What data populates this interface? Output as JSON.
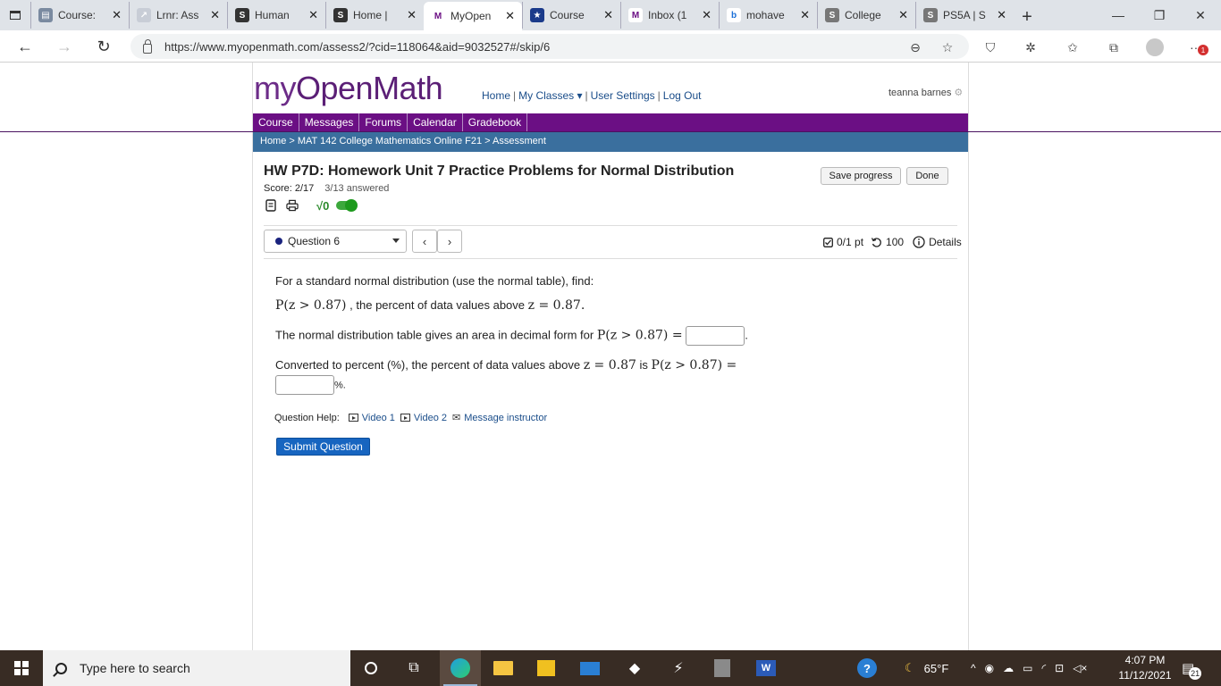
{
  "browser": {
    "tabs": [
      {
        "label": "Course:",
        "fav_bg": "#7a8aa0",
        "fav": "▤"
      },
      {
        "label": "Lrnr: Ass",
        "fav_bg": "#c8cdd6",
        "fav": "↗"
      },
      {
        "label": "Human",
        "fav_bg": "#333333",
        "fav": "S"
      },
      {
        "label": "Home |",
        "fav_bg": "#333333",
        "fav": "S"
      },
      {
        "label": "MyOpen",
        "fav_bg": "#ffffff",
        "fav": "M",
        "active": true
      },
      {
        "label": "Course",
        "fav_bg": "#1a3a8a",
        "fav": "★"
      },
      {
        "label": "Inbox (1",
        "fav_bg": "#ffffff",
        "fav": "M"
      },
      {
        "label": "mohave",
        "fav_bg": "#ffffff",
        "fav": "b"
      },
      {
        "label": "College",
        "fav_bg": "#777777",
        "fav": "S"
      },
      {
        "label": "PS5A | S",
        "fav_bg": "#777777",
        "fav": "S"
      }
    ],
    "url": "https://www.myopenmath.com/assess2/?cid=118064&aid=9032527#/skip/6",
    "ext_badge": "1"
  },
  "site": {
    "logo_my": "my",
    "logo_rest": "OpenMath",
    "nav_home": "Home",
    "nav_classes": "My Classes ▾",
    "nav_settings": "User Settings",
    "nav_logout": "Log Out",
    "user": "teanna barnes",
    "menu": [
      "Course",
      "Messages",
      "Forums",
      "Calendar",
      "Gradebook"
    ],
    "breadcrumb": "Home > MAT 142 College Mathematics Online F21 > Assessment"
  },
  "assessment": {
    "title": "HW P7D: Homework Unit 7 Practice Problems for Normal Distribution",
    "score": "Score: 2/17",
    "answered": "3/13 answered",
    "save_label": "Save progress",
    "done_label": "Done",
    "question_select": "Question 6",
    "points": "0/1 pt",
    "attempts": "100",
    "details": "Details"
  },
  "question": {
    "line1": "For a standard normal distribution (use the normal table), find:",
    "line2_math": "P(z > 0.87)",
    "line2_text": ", the percent of data values above",
    "line2_eq": "z = 0.87.",
    "line3_text": "The normal distribution table gives an area in decimal form for",
    "line3_math": "P(z > 0.87) =",
    "line4_text": "Converted to percent (%), the percent of data values above",
    "line4_eq": "z = 0.87",
    "line4_is": "is",
    "line4_math": "P(z > 0.87) =",
    "percent_sign": "%.",
    "help_label": "Question Help:",
    "video1": "Video 1",
    "video2": "Video 2",
    "message": "Message instructor",
    "submit": "Submit Question"
  },
  "taskbar": {
    "search_placeholder": "Type here to search",
    "temp": "65°F",
    "time": "4:07 PM",
    "date": "11/12/2021",
    "notif_count": "21"
  }
}
